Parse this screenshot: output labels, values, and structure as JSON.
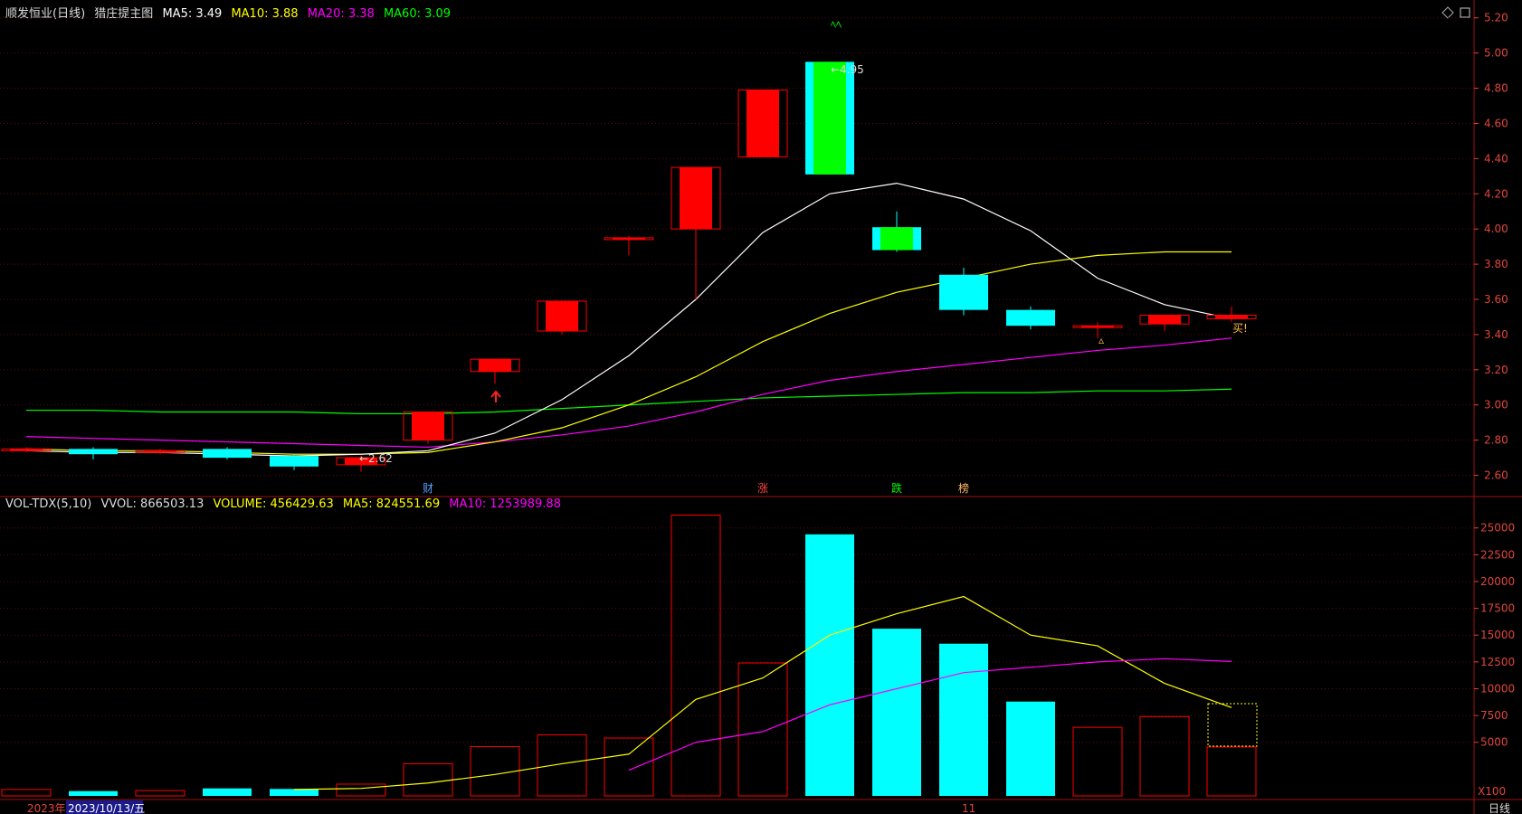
{
  "price_header": {
    "stock_name": "顺发恒业(日线)",
    "indicator": "猎庄提主图",
    "ma5": "MA5: 3.49",
    "ma10": "MA10: 3.88",
    "ma20": "MA20: 3.38",
    "ma60": "MA60: 3.09"
  },
  "vol_header": {
    "name": "VOL-TDX(5,10)",
    "vvol": "VVOL: 866503.13",
    "volume": "VOLUME: 456429.63",
    "ma5": "MA5: 824551.69",
    "ma10": "MA10: 1253989.88"
  },
  "price_axis": [
    "5.20",
    "5.00",
    "4.80",
    "4.60",
    "4.40",
    "4.20",
    "4.00",
    "3.80",
    "3.60",
    "3.40",
    "3.20",
    "3.00",
    "2.80",
    "2.60"
  ],
  "volume_axis": [
    "25000",
    "22500",
    "20000",
    "17500",
    "15000",
    "12500",
    "10000",
    "7500",
    "5000"
  ],
  "volume_unit": "X100",
  "period_label": "日线",
  "annotations": {
    "low_label": "←2.62",
    "high_label": "←4.95",
    "buy_label": "买!",
    "event_cai": "财",
    "event_zhang": "涨",
    "event_die": "跌",
    "event_bang": "榜"
  },
  "bottom_bar": {
    "year": "2023年",
    "cursor_date": "2023/10/13/五",
    "month_mark": "11"
  },
  "colors": {
    "up": "#ff0000",
    "down": "#00ffff",
    "limit_down": "#00ff00",
    "ma5": "#ffffff",
    "ma10": "#ffff00",
    "ma20": "#ff00ff",
    "ma60": "#00ff00",
    "axis": "#e0463a"
  },
  "chart_data": {
    "type": "candlestick",
    "candles": [
      {
        "o": 2.75,
        "h": 2.76,
        "l": 2.73,
        "c": 2.74,
        "dir": "up"
      },
      {
        "o": 2.75,
        "h": 2.76,
        "l": 2.69,
        "c": 2.72,
        "dir": "down"
      },
      {
        "o": 2.74,
        "h": 2.75,
        "l": 2.72,
        "c": 2.73,
        "dir": "up"
      },
      {
        "o": 2.75,
        "h": 2.76,
        "l": 2.69,
        "c": 2.7,
        "dir": "down"
      },
      {
        "o": 2.71,
        "h": 2.72,
        "l": 2.63,
        "c": 2.65,
        "dir": "down"
      },
      {
        "o": 2.66,
        "h": 2.71,
        "l": 2.62,
        "c": 2.7,
        "dir": "up"
      },
      {
        "o": 2.8,
        "h": 2.96,
        "l": 2.78,
        "c": 2.96,
        "dir": "up"
      },
      {
        "o": 3.19,
        "h": 3.26,
        "l": 3.12,
        "c": 3.26,
        "dir": "up"
      },
      {
        "o": 3.42,
        "h": 3.59,
        "l": 3.4,
        "c": 3.59,
        "dir": "up"
      },
      {
        "o": 3.95,
        "h": 3.96,
        "l": 3.85,
        "c": 3.95,
        "dir": "up"
      },
      {
        "o": 4.0,
        "h": 4.35,
        "l": 3.6,
        "c": 4.35,
        "dir": "up"
      },
      {
        "o": 4.41,
        "h": 4.79,
        "l": 4.41,
        "c": 4.79,
        "dir": "up"
      },
      {
        "o": 4.95,
        "h": 4.95,
        "l": 4.31,
        "c": 4.31,
        "dir": "limit_down"
      },
      {
        "o": 4.01,
        "h": 4.1,
        "l": 3.87,
        "c": 3.88,
        "dir": "limit_down"
      },
      {
        "o": 3.74,
        "h": 3.78,
        "l": 3.51,
        "c": 3.54,
        "dir": "down"
      },
      {
        "o": 3.54,
        "h": 3.56,
        "l": 3.43,
        "c": 3.45,
        "dir": "down"
      },
      {
        "o": 3.44,
        "h": 3.47,
        "l": 3.38,
        "c": 3.45,
        "dir": "up"
      },
      {
        "o": 3.46,
        "h": 3.51,
        "l": 3.42,
        "c": 3.51,
        "dir": "up"
      },
      {
        "o": 3.49,
        "h": 3.56,
        "l": 3.47,
        "c": 3.51,
        "dir": "up"
      }
    ],
    "ma5": [
      2.74,
      2.73,
      2.73,
      2.72,
      2.71,
      2.72,
      2.74,
      2.84,
      3.03,
      3.28,
      3.6,
      3.98,
      4.2,
      4.26,
      4.17,
      3.99,
      3.72,
      3.57,
      3.49
    ],
    "ma10": [
      2.75,
      2.74,
      2.74,
      2.73,
      2.72,
      2.72,
      2.73,
      2.79,
      2.87,
      3.0,
      3.16,
      3.36,
      3.52,
      3.64,
      3.72,
      3.8,
      3.85,
      3.87,
      3.87
    ],
    "ma20": [
      2.82,
      2.81,
      2.8,
      2.79,
      2.78,
      2.77,
      2.76,
      2.79,
      2.83,
      2.88,
      2.96,
      3.06,
      3.14,
      3.19,
      3.23,
      3.27,
      3.31,
      3.34,
      3.38
    ],
    "ma60": [
      2.97,
      2.97,
      2.96,
      2.96,
      2.96,
      2.95,
      2.95,
      2.96,
      2.98,
      3.0,
      3.02,
      3.04,
      3.05,
      3.06,
      3.07,
      3.07,
      3.08,
      3.08,
      3.09
    ],
    "volume": [
      600,
      450,
      500,
      700,
      650,
      1100,
      3000,
      4600,
      5700,
      5400,
      26200,
      12400,
      24400,
      15600,
      14200,
      8800,
      6400,
      7400,
      4564
    ],
    "vol_ma5": [
      null,
      null,
      null,
      null,
      600,
      700,
      1200,
      2000,
      3000,
      3900,
      9000,
      11000,
      15000,
      17000,
      18600,
      15000,
      14000,
      10500,
      8246
    ],
    "vol_ma10": [
      null,
      null,
      null,
      null,
      null,
      null,
      null,
      null,
      null,
      2400,
      5000,
      6000,
      8500,
      10000,
      11500,
      12000,
      12500,
      12800,
      12540
    ],
    "price_range": [
      2.5,
      5.25
    ],
    "volume_range": [
      0,
      27000
    ],
    "events": [
      {
        "index": 6,
        "key": "event_cai",
        "color": "#5aa0ff"
      },
      {
        "index": 11,
        "key": "event_zhang",
        "color": "#ff4040"
      },
      {
        "index": 13,
        "key": "event_die",
        "color": "#00ff00"
      },
      {
        "index": 14,
        "key": "event_bang",
        "color": "#ffbb66"
      }
    ]
  }
}
